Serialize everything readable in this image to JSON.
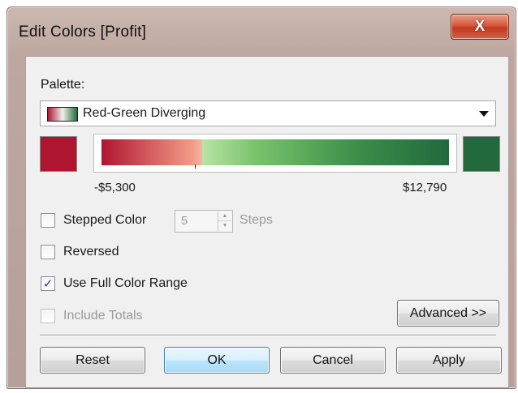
{
  "window": {
    "title": "Edit Colors [Profit]",
    "close_glyph": "X"
  },
  "palette": {
    "label": "Palette:",
    "selected": "Red-Green Diverging"
  },
  "range": {
    "min_label": "-$5,300",
    "max_label": "$12,790",
    "min_color": "#b01530",
    "max_color": "#226a3e",
    "center_position": 0.29
  },
  "options": {
    "stepped_color": {
      "label": "Stepped Color",
      "checked": false,
      "steps_value": "5",
      "steps_label": "Steps"
    },
    "reversed": {
      "label": "Reversed",
      "checked": false
    },
    "use_full_color_range": {
      "label": "Use Full Color Range",
      "checked": true,
      "check_glyph": "✓"
    },
    "include_totals": {
      "label": "Include Totals",
      "checked": false,
      "disabled": true
    }
  },
  "buttons": {
    "advanced": "Advanced >>",
    "reset": "Reset",
    "ok": "OK",
    "cancel": "Cancel",
    "apply": "Apply"
  },
  "icons": {
    "close": "close-icon",
    "dropdown": "chevron-down-icon",
    "stepper_up": "▲",
    "stepper_down": "▼"
  }
}
